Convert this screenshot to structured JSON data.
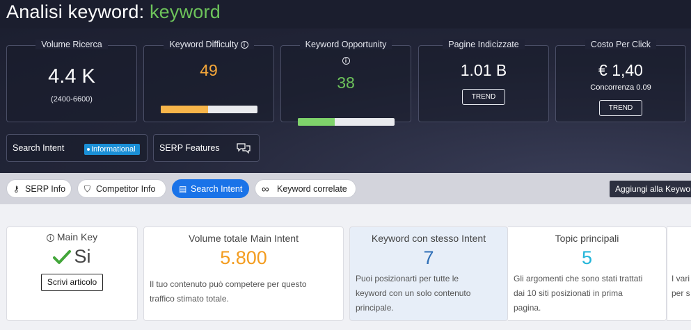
{
  "header": {
    "title_prefix": "Analisi keyword: ",
    "keyword": "keyword"
  },
  "metrics": {
    "volume": {
      "title": "Volume Ricerca",
      "value": "4.4 K",
      "range": "(2400-6600)"
    },
    "difficulty": {
      "title": "Keyword Difficulty",
      "info": "i",
      "value": "49",
      "progress": 0.49,
      "color": "#f7a83a"
    },
    "opportunity": {
      "title": "Keyword Opportunity",
      "info": "i",
      "value": "38",
      "progress": 0.38,
      "color": "#6dc35b"
    },
    "indexed": {
      "title": "Pagine Indicizzate",
      "value": "1.01 B",
      "button": "TREND"
    },
    "cpc": {
      "title": "Costo Per Click",
      "value": "€ 1,40",
      "competition": "Concorrenza 0.09",
      "button": "TREND"
    }
  },
  "search_intent": {
    "label": "Search Intent",
    "badge": "Informational"
  },
  "serp_features": {
    "label": "SERP Features",
    "icon": "chat-bubbles-icon"
  },
  "tabs": [
    {
      "label": "SERP Info",
      "icon": "key-icon",
      "glyph": "⚷"
    },
    {
      "label": "Competitor Info",
      "icon": "badge-icon",
      "glyph": "⛉"
    },
    {
      "label": "Search Intent",
      "icon": "document-icon",
      "glyph": "▤",
      "active": true
    },
    {
      "label": "Keyword correlate",
      "icon": "infinity-icon",
      "glyph": "∞"
    }
  ],
  "tooltip": "Aggiungi alla Keywor",
  "cards": {
    "main_key": {
      "title": "Main Key",
      "info": "i",
      "value": "Si",
      "button": "Scrivi articolo"
    },
    "volume_total": {
      "title": "Volume totale Main Intent",
      "value": "5.800",
      "desc_line1": "Il tuo contenuto può competere per questo",
      "desc_line2": "traffico stimato totale.",
      "color": "#f39c1f"
    },
    "same_intent": {
      "title": "Keyword con stesso Intent",
      "value": "7",
      "desc_line1": "Puoi posizionarti per tutte le",
      "desc_line2": "keyword con un solo contenuto",
      "desc_line3": "principale.",
      "color": "#2f6fb7"
    },
    "topics": {
      "title": "Topic principali",
      "value": "5",
      "desc_line1": "Gli argomenti che sono stati trattati",
      "desc_line2": "dai 10 siti posizionati in prima",
      "desc_line3": "pagina.",
      "color": "#22b5d9"
    },
    "partial": {
      "desc_line1": "I vari",
      "desc_line2": "per s"
    }
  }
}
